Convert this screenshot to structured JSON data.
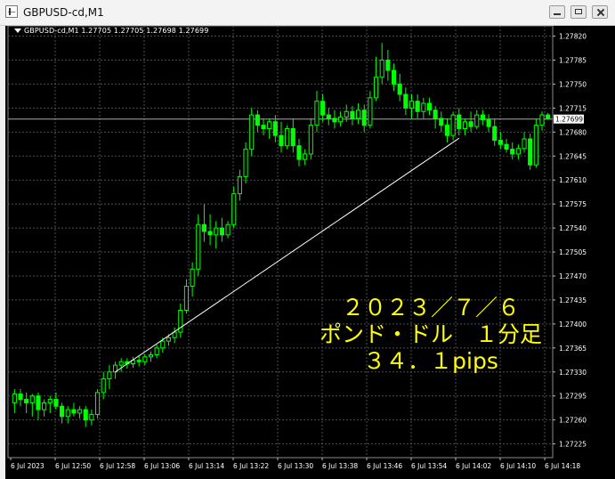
{
  "window": {
    "title": "GBPUSD-cd,M1",
    "icon": "chart-window-icon",
    "buttons": [
      "minimize",
      "maximize",
      "close"
    ]
  },
  "chart": {
    "infobar": "GBPUSD-cd,M1  1.27705 1.27705 1.27698 1.27699",
    "current_price": "1.27699",
    "price_labels": [
      "1.27820",
      "1.27785",
      "1.27750",
      "1.27715",
      "1.27680",
      "1.27645",
      "1.27610",
      "1.27575",
      "1.27540",
      "1.27505",
      "1.27470",
      "1.27435",
      "1.27400",
      "1.27365",
      "1.27330",
      "1.27295",
      "1.27260",
      "1.27225"
    ],
    "time_labels": [
      "6 Jul 2023",
      "6 Jul 12:50",
      "6 Jul 12:58",
      "6 Jul 13:06",
      "6 Jul 13:14",
      "6 Jul 13:22",
      "6 Jul 13:30",
      "6 Jul 13:38",
      "6 Jul 13:46",
      "6 Jul 13:54",
      "6 Jul 14:02",
      "6 Jul 14:10",
      "6 Jul 14:18"
    ],
    "overlay_lines": [
      "２０２３／７／６",
      "ポンド・ドル　１分足",
      "３４．１pips"
    ],
    "colors": {
      "background": "#000000",
      "grid": "#4f4f4f",
      "candle": "#00ff00",
      "text": "#ffffff",
      "overlay": "#ffff00"
    }
  },
  "chart_data": {
    "type": "candlestick",
    "symbol": "GBPUSD-cd",
    "timeframe": "M1",
    "ylim": [
      1.27205,
      1.27835
    ],
    "candles": [
      {
        "o": 1.27285,
        "h": 1.27305,
        "l": 1.2727,
        "c": 1.27298
      },
      {
        "o": 1.27298,
        "h": 1.27305,
        "l": 1.2728,
        "c": 1.2729
      },
      {
        "o": 1.2729,
        "h": 1.273,
        "l": 1.2727,
        "c": 1.27285
      },
      {
        "o": 1.27285,
        "h": 1.27298,
        "l": 1.27265,
        "c": 1.27295
      },
      {
        "o": 1.27295,
        "h": 1.273,
        "l": 1.2726,
        "c": 1.27275
      },
      {
        "o": 1.27275,
        "h": 1.2729,
        "l": 1.27265,
        "c": 1.27285
      },
      {
        "o": 1.27285,
        "h": 1.27295,
        "l": 1.2727,
        "c": 1.2729
      },
      {
        "o": 1.2729,
        "h": 1.273,
        "l": 1.27275,
        "c": 1.2728
      },
      {
        "o": 1.2728,
        "h": 1.27285,
        "l": 1.27255,
        "c": 1.27265
      },
      {
        "o": 1.27265,
        "h": 1.2728,
        "l": 1.27255,
        "c": 1.27275
      },
      {
        "o": 1.27275,
        "h": 1.27285,
        "l": 1.27265,
        "c": 1.2727
      },
      {
        "o": 1.2727,
        "h": 1.2728,
        "l": 1.27262,
        "c": 1.27275
      },
      {
        "o": 1.27275,
        "h": 1.2728,
        "l": 1.2725,
        "c": 1.2726
      },
      {
        "o": 1.2726,
        "h": 1.27275,
        "l": 1.27252,
        "c": 1.27268
      },
      {
        "o": 1.27268,
        "h": 1.27305,
        "l": 1.27262,
        "c": 1.273
      },
      {
        "o": 1.273,
        "h": 1.2733,
        "l": 1.2729,
        "c": 1.2732
      },
      {
        "o": 1.2732,
        "h": 1.2734,
        "l": 1.27305,
        "c": 1.2733
      },
      {
        "o": 1.2733,
        "h": 1.27345,
        "l": 1.2732,
        "c": 1.2734
      },
      {
        "o": 1.2734,
        "h": 1.2735,
        "l": 1.2733,
        "c": 1.27345
      },
      {
        "o": 1.27345,
        "h": 1.2735,
        "l": 1.27335,
        "c": 1.27342
      },
      {
        "o": 1.27342,
        "h": 1.27352,
        "l": 1.27336,
        "c": 1.27347
      },
      {
        "o": 1.27347,
        "h": 1.27354,
        "l": 1.27338,
        "c": 1.27345
      },
      {
        "o": 1.27345,
        "h": 1.27356,
        "l": 1.2734,
        "c": 1.27352
      },
      {
        "o": 1.27352,
        "h": 1.2736,
        "l": 1.27345,
        "c": 1.27355
      },
      {
        "o": 1.27355,
        "h": 1.2737,
        "l": 1.2735,
        "c": 1.27365
      },
      {
        "o": 1.27365,
        "h": 1.2738,
        "l": 1.27358,
        "c": 1.27375
      },
      {
        "o": 1.27375,
        "h": 1.27385,
        "l": 1.27368,
        "c": 1.2738
      },
      {
        "o": 1.2738,
        "h": 1.27395,
        "l": 1.27372,
        "c": 1.27388
      },
      {
        "o": 1.27388,
        "h": 1.2743,
        "l": 1.2738,
        "c": 1.2742
      },
      {
        "o": 1.2742,
        "h": 1.27465,
        "l": 1.27415,
        "c": 1.27455
      },
      {
        "o": 1.27455,
        "h": 1.2749,
        "l": 1.2744,
        "c": 1.2748
      },
      {
        "o": 1.2748,
        "h": 1.2756,
        "l": 1.2747,
        "c": 1.27545
      },
      {
        "o": 1.27545,
        "h": 1.27575,
        "l": 1.2752,
        "c": 1.27535
      },
      {
        "o": 1.27535,
        "h": 1.2756,
        "l": 1.27515,
        "c": 1.2753
      },
      {
        "o": 1.2753,
        "h": 1.2755,
        "l": 1.2751,
        "c": 1.2754
      },
      {
        "o": 1.2754,
        "h": 1.27555,
        "l": 1.2752,
        "c": 1.2753
      },
      {
        "o": 1.2753,
        "h": 1.2755,
        "l": 1.27525,
        "c": 1.27545
      },
      {
        "o": 1.27545,
        "h": 1.276,
        "l": 1.2754,
        "c": 1.2759
      },
      {
        "o": 1.2759,
        "h": 1.27625,
        "l": 1.2758,
        "c": 1.27615
      },
      {
        "o": 1.27615,
        "h": 1.27665,
        "l": 1.27605,
        "c": 1.27655
      },
      {
        "o": 1.27655,
        "h": 1.27715,
        "l": 1.27645,
        "c": 1.27705
      },
      {
        "o": 1.27705,
        "h": 1.27712,
        "l": 1.2768,
        "c": 1.2769
      },
      {
        "o": 1.2769,
        "h": 1.277,
        "l": 1.27675,
        "c": 1.27685
      },
      {
        "o": 1.27685,
        "h": 1.277,
        "l": 1.2767,
        "c": 1.27695
      },
      {
        "o": 1.27695,
        "h": 1.27705,
        "l": 1.27665,
        "c": 1.27675
      },
      {
        "o": 1.27675,
        "h": 1.27695,
        "l": 1.2765,
        "c": 1.2766
      },
      {
        "o": 1.2766,
        "h": 1.2769,
        "l": 1.27655,
        "c": 1.27685
      },
      {
        "o": 1.27685,
        "h": 1.277,
        "l": 1.2765,
        "c": 1.2766
      },
      {
        "o": 1.2766,
        "h": 1.2767,
        "l": 1.2763,
        "c": 1.2764
      },
      {
        "o": 1.2764,
        "h": 1.27655,
        "l": 1.27632,
        "c": 1.27648
      },
      {
        "o": 1.27648,
        "h": 1.277,
        "l": 1.2764,
        "c": 1.2769
      },
      {
        "o": 1.2769,
        "h": 1.2774,
        "l": 1.2768,
        "c": 1.27725
      },
      {
        "o": 1.27725,
        "h": 1.27735,
        "l": 1.27695,
        "c": 1.27705
      },
      {
        "o": 1.27705,
        "h": 1.27715,
        "l": 1.2769,
        "c": 1.277
      },
      {
        "o": 1.277,
        "h": 1.27712,
        "l": 1.27685,
        "c": 1.27695
      },
      {
        "o": 1.27695,
        "h": 1.2771,
        "l": 1.27688,
        "c": 1.27702
      },
      {
        "o": 1.27702,
        "h": 1.2772,
        "l": 1.27695,
        "c": 1.2771
      },
      {
        "o": 1.2771,
        "h": 1.27718,
        "l": 1.2769,
        "c": 1.277
      },
      {
        "o": 1.277,
        "h": 1.27722,
        "l": 1.27692,
        "c": 1.27712
      },
      {
        "o": 1.27712,
        "h": 1.2772,
        "l": 1.2768,
        "c": 1.2769
      },
      {
        "o": 1.2769,
        "h": 1.2774,
        "l": 1.27685,
        "c": 1.2773
      },
      {
        "o": 1.2773,
        "h": 1.2779,
        "l": 1.27725,
        "c": 1.2776
      },
      {
        "o": 1.2776,
        "h": 1.2781,
        "l": 1.2775,
        "c": 1.27785
      },
      {
        "o": 1.27785,
        "h": 1.278,
        "l": 1.27755,
        "c": 1.2777
      },
      {
        "o": 1.2777,
        "h": 1.2778,
        "l": 1.2774,
        "c": 1.2775
      },
      {
        "o": 1.2775,
        "h": 1.27765,
        "l": 1.27725,
        "c": 1.27735
      },
      {
        "o": 1.27735,
        "h": 1.27745,
        "l": 1.27705,
        "c": 1.27715
      },
      {
        "o": 1.27715,
        "h": 1.27735,
        "l": 1.277,
        "c": 1.27725
      },
      {
        "o": 1.27725,
        "h": 1.27735,
        "l": 1.277,
        "c": 1.2771
      },
      {
        "o": 1.2771,
        "h": 1.2773,
        "l": 1.277,
        "c": 1.27722
      },
      {
        "o": 1.27722,
        "h": 1.2773,
        "l": 1.27705,
        "c": 1.27712
      },
      {
        "o": 1.27712,
        "h": 1.27718,
        "l": 1.27685,
        "c": 1.277
      },
      {
        "o": 1.277,
        "h": 1.2771,
        "l": 1.2768,
        "c": 1.2769
      },
      {
        "o": 1.2769,
        "h": 1.277,
        "l": 1.27665,
        "c": 1.27675
      },
      {
        "o": 1.27675,
        "h": 1.2771,
        "l": 1.27668,
        "c": 1.27705
      },
      {
        "o": 1.27705,
        "h": 1.27715,
        "l": 1.27675,
        "c": 1.27685
      },
      {
        "o": 1.27685,
        "h": 1.277,
        "l": 1.27675,
        "c": 1.27695
      },
      {
        "o": 1.27695,
        "h": 1.2771,
        "l": 1.2768,
        "c": 1.27688
      },
      {
        "o": 1.27688,
        "h": 1.27712,
        "l": 1.27684,
        "c": 1.27705
      },
      {
        "o": 1.27705,
        "h": 1.27712,
        "l": 1.2769,
        "c": 1.27698
      },
      {
        "o": 1.27698,
        "h": 1.27706,
        "l": 1.2768,
        "c": 1.27688
      },
      {
        "o": 1.27688,
        "h": 1.277,
        "l": 1.2766,
        "c": 1.27668
      },
      {
        "o": 1.27668,
        "h": 1.2768,
        "l": 1.27655,
        "c": 1.27662
      },
      {
        "o": 1.27662,
        "h": 1.2767,
        "l": 1.2765,
        "c": 1.27655
      },
      {
        "o": 1.27655,
        "h": 1.27665,
        "l": 1.2764,
        "c": 1.27648
      },
      {
        "o": 1.27648,
        "h": 1.27662,
        "l": 1.2764,
        "c": 1.27656
      },
      {
        "o": 1.27656,
        "h": 1.2768,
        "l": 1.2765,
        "c": 1.2767
      },
      {
        "o": 1.2767,
        "h": 1.27678,
        "l": 1.27625,
        "c": 1.27632
      },
      {
        "o": 1.27632,
        "h": 1.277,
        "l": 1.27628,
        "c": 1.2769
      },
      {
        "o": 1.2769,
        "h": 1.2771,
        "l": 1.27682,
        "c": 1.27705
      },
      {
        "o": 1.27705,
        "h": 1.27708,
        "l": 1.27698,
        "c": 1.27699
      }
    ],
    "trendline": {
      "from_index": 17,
      "from_price": 1.2733,
      "to_index": 75,
      "to_price": 1.27671
    },
    "current_price": 1.27699
  }
}
